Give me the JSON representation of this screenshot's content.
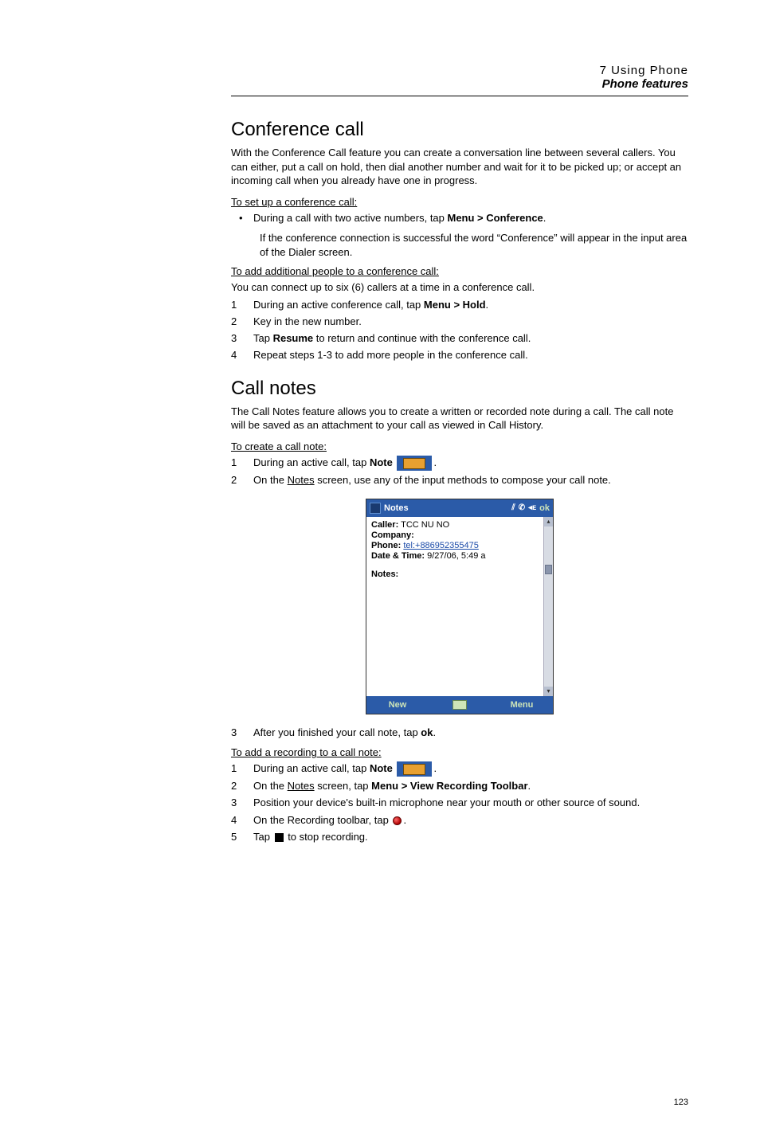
{
  "header": {
    "chapter": "7 Using Phone",
    "section": "Phone features"
  },
  "conf": {
    "title": "Conference call",
    "intro": "With the Conference Call feature you can create a conversation line between several callers. You can either, put a call on hold, then dial another number and wait for it to be picked up; or accept an incoming call when you already have one in progress.",
    "setup_h": "To set up a conference call:",
    "bullet_pre": "During a call with two active numbers, tap ",
    "bullet_menu": "Menu > Conference",
    "bullet_post": ".",
    "bullet_sub": "If the conference connection is successful the word “Conference” will appear in the input area of the Dialer screen.",
    "add_h": "To add additional people to a conference call:",
    "add_intro": "You can connect up to six (6) callers at a time in a conference call.",
    "steps": [
      {
        "pre": "During an active conference call, tap ",
        "bold": "Menu > Hold",
        "post": "."
      },
      {
        "pre": "Key in the new number."
      },
      {
        "pre": "Tap ",
        "bold": "Resume",
        "post": " to return and continue with the conference call."
      },
      {
        "pre": "Repeat steps 1-3 to add more people in the conference call."
      }
    ]
  },
  "notes": {
    "title": "Call notes",
    "intro": "The Call Notes feature allows you to create a written or recorded note during a call. The call note will be saved as an attachment to your call as viewed in Call History.",
    "create_h": "To create a call note:",
    "step1_pre": "During an active call, tap ",
    "step1_bold": "Note",
    "step1_post": ".",
    "step2_pre": "On the ",
    "step2_u": "Notes",
    "step2_post": " screen, use any of the input methods to compose your call note.",
    "step3_pre": "After you finished your call note, tap ",
    "step3_bold": "ok",
    "step3_post": ".",
    "rec_h": "To add a recording to a call note:",
    "rstep1_pre": "During an active call, tap ",
    "rstep1_bold": "Note",
    "rstep1_post": ".",
    "rstep2_pre": "On the ",
    "rstep2_u": "Notes",
    "rstep2_mid": " screen, tap ",
    "rstep2_bold": "Menu > View Recording Toolbar",
    "rstep2_post": ".",
    "rstep3": "Position your device's built-in microphone near your mouth or other source of sound.",
    "rstep4_pre": "On the Recording toolbar, tap ",
    "rstep4_post": ".",
    "rstep5_pre": "Tap ",
    "rstep5_post": " to stop recording."
  },
  "screenshot": {
    "title": "Notes",
    "ok": "ok",
    "caller_lbl": "Caller:",
    "caller_val": " TCC NU NO",
    "company_lbl": "Company:",
    "phone_lbl": "Phone:",
    "phone_link": "tel:+886952355475",
    "dt_lbl": "Date & Time:",
    "dt_val": " 9/27/06, 5:49 a",
    "notes_lbl": "Notes:",
    "new": "New",
    "menu": "Menu"
  },
  "pagenum": "123"
}
